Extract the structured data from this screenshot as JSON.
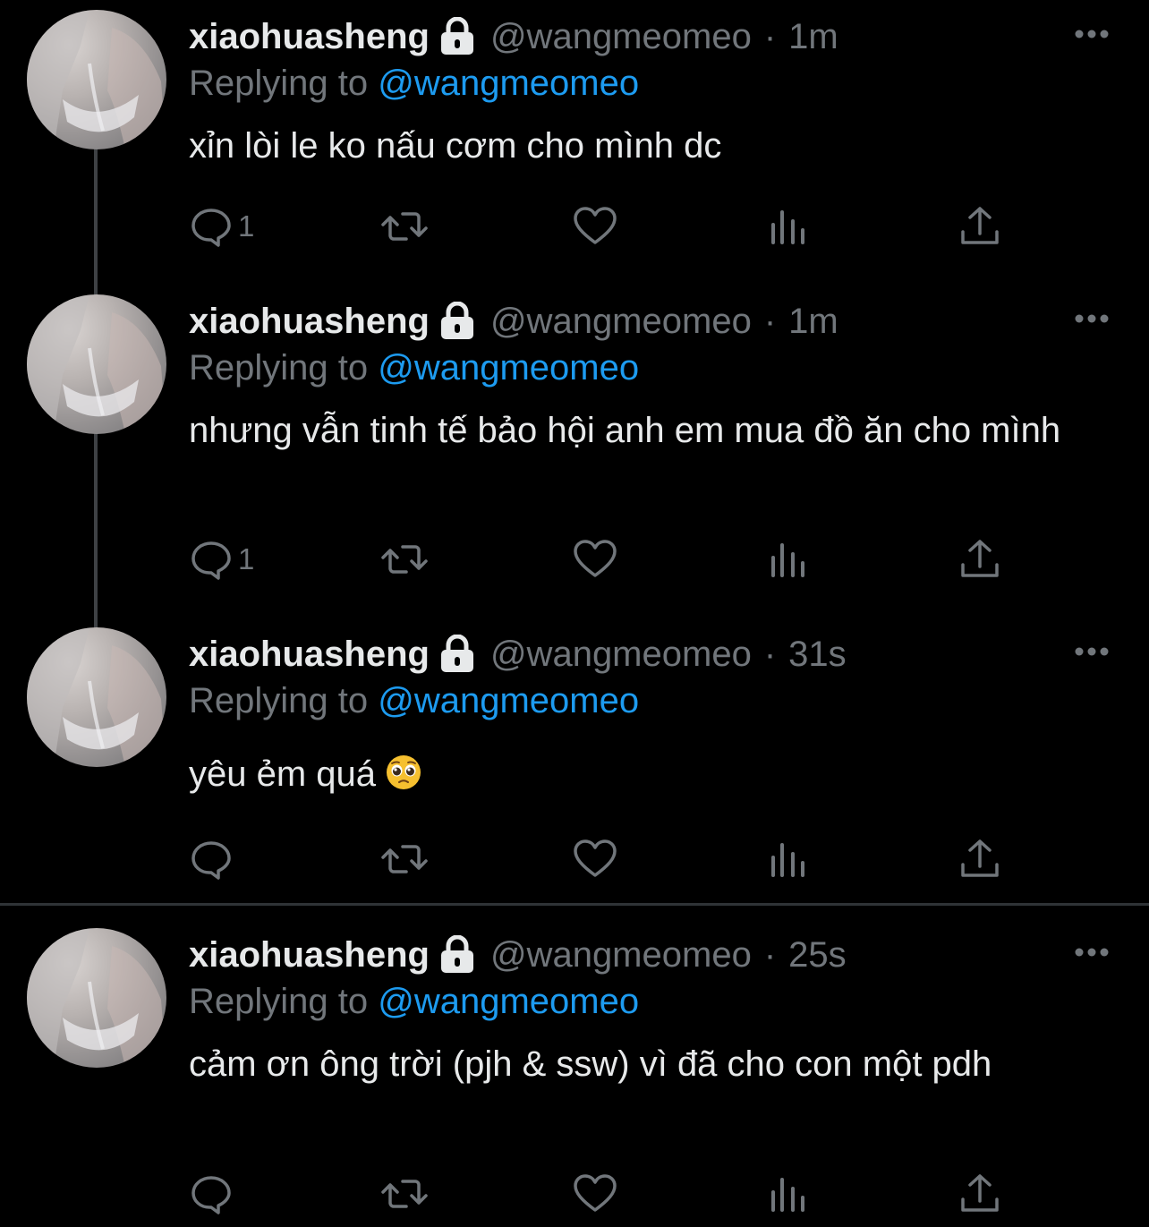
{
  "user": {
    "display_name": "xiaohuasheng",
    "handle": "@wangmeomeo",
    "separator": "·",
    "replying_prefix": "Replying to",
    "replying_mention": "@wangmeomeo"
  },
  "tweets": [
    {
      "time": "1m",
      "text": "xỉn lòi le ko nấu cơm cho mình dc",
      "reply_count": "1"
    },
    {
      "time": "1m",
      "text": "nhưng vẫn tinh tế bảo hội anh em mua đồ ăn cho mình",
      "reply_count": "1"
    },
    {
      "time": "31s",
      "text": "yêu ẻm quá",
      "reply_count": ""
    },
    {
      "time": "25s",
      "text": "cảm ơn ông trời (pjh & ssw) vì đã cho con một pdh",
      "reply_count": ""
    }
  ],
  "icons": {
    "lock": "lock-icon",
    "more": "more-icon",
    "reply": "reply-icon",
    "retweet": "retweet-icon",
    "like": "heart-icon",
    "views": "views-icon",
    "share": "share-icon",
    "emoji": "pleading-face-emoji"
  },
  "colors": {
    "background": "#000000",
    "text": "#e7e9ea",
    "secondary": "#71767b",
    "mention": "#1d9bf0",
    "divider": "#2f3336",
    "thread_line": "#3e4144"
  }
}
